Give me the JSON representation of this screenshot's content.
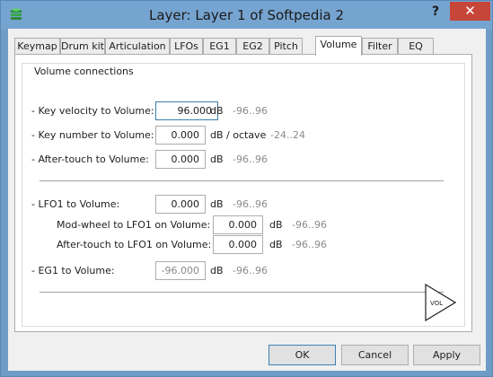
{
  "window": {
    "title": "Layer: Layer 1 of Softpedia 2",
    "help_label": "?",
    "close_label": "✕"
  },
  "tabs": [
    {
      "label": "Keymap"
    },
    {
      "label": "Drum kit"
    },
    {
      "label": "Articulation"
    },
    {
      "label": "LFOs"
    },
    {
      "label": "EG1"
    },
    {
      "label": "EG2"
    },
    {
      "label": "Pitch"
    },
    {
      "label": "Volume",
      "active": true
    },
    {
      "label": "Filter"
    },
    {
      "label": "EQ"
    }
  ],
  "group": {
    "title": "Volume connections",
    "rows": [
      {
        "label": "-  Key velocity to Volume:",
        "value": "96.000",
        "unit": "dB",
        "range": "-96..96"
      },
      {
        "label": "-  Key number to Volume:",
        "value": "0.000",
        "unit": "dB / octave",
        "range": "-24..24"
      },
      {
        "label": "-  After-touch to Volume:",
        "value": "0.000",
        "unit": "dB",
        "range": "-96..96"
      },
      {
        "label": "-  LFO1 to Volume:",
        "value": "0.000",
        "unit": "dB",
        "range": "-96..96"
      },
      {
        "label": "Mod-wheel to LFO1 on Volume:",
        "value": "0.000",
        "unit": "dB",
        "range": "-96..96"
      },
      {
        "label": "After-touch to LFO1 on Volume:",
        "value": "0.000",
        "unit": "dB",
        "range": "-96..96"
      },
      {
        "label": "-  EG1 to Volume:",
        "value": "-96.000",
        "unit": "dB",
        "range": "-96..96"
      }
    ]
  },
  "vol_icon_label": "VOL",
  "buttons": {
    "ok": "OK",
    "cancel": "Cancel",
    "apply": "Apply"
  }
}
